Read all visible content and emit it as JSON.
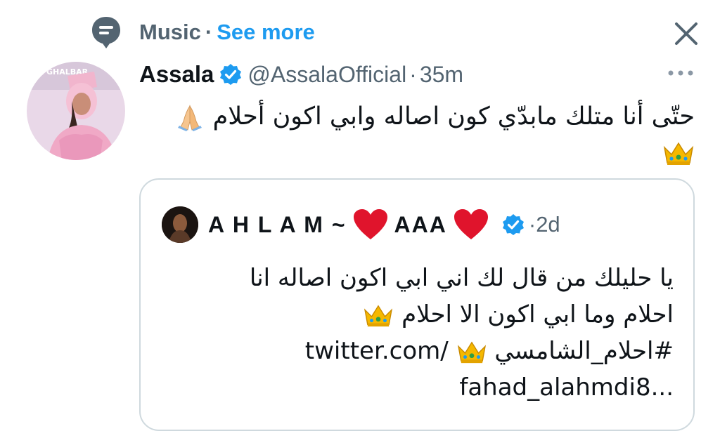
{
  "topic": {
    "icon": "topic-pin-icon",
    "label": "Music",
    "separator": "·",
    "see_more": "See more"
  },
  "close": {
    "icon": "close-icon"
  },
  "tweet": {
    "author_name": "Assala",
    "verified_icon": "verified-badge-icon",
    "handle": "@AssalaOfficial",
    "dot": "·",
    "time": "35m",
    "more_icon": "more-dots-icon",
    "text_line1": "حتّى أنا متلك مابدّي كون اصاله وابي اكون أحلام",
    "text_line1_emoji": "folded-hands-emoji",
    "text_line2_emoji": "crown-emoji"
  },
  "quote": {
    "author_name": "A H L A M ~",
    "heart_icon": "red-heart-emoji",
    "name_middle": "AAA",
    "verified_icon": "verified-badge-icon",
    "dot": "·",
    "time": "2d",
    "line1": "يا حليلك من قال لك اني ابي اكون اصاله  انا",
    "line2": "احلام وما ابي اكون الا احلام",
    "hashtag": "#احلام_الشامسي",
    "link_part1": "twitter.com/",
    "line4": "fahad_alahmdi8...",
    "crown_icon": "crown-emoji"
  },
  "colors": {
    "text_primary": "#0f1419",
    "text_secondary": "#536471",
    "accent_blue": "#1d9bf0",
    "border": "#cfd9de",
    "heart_red": "#e0142c",
    "crown_gold": "#f5b800"
  }
}
